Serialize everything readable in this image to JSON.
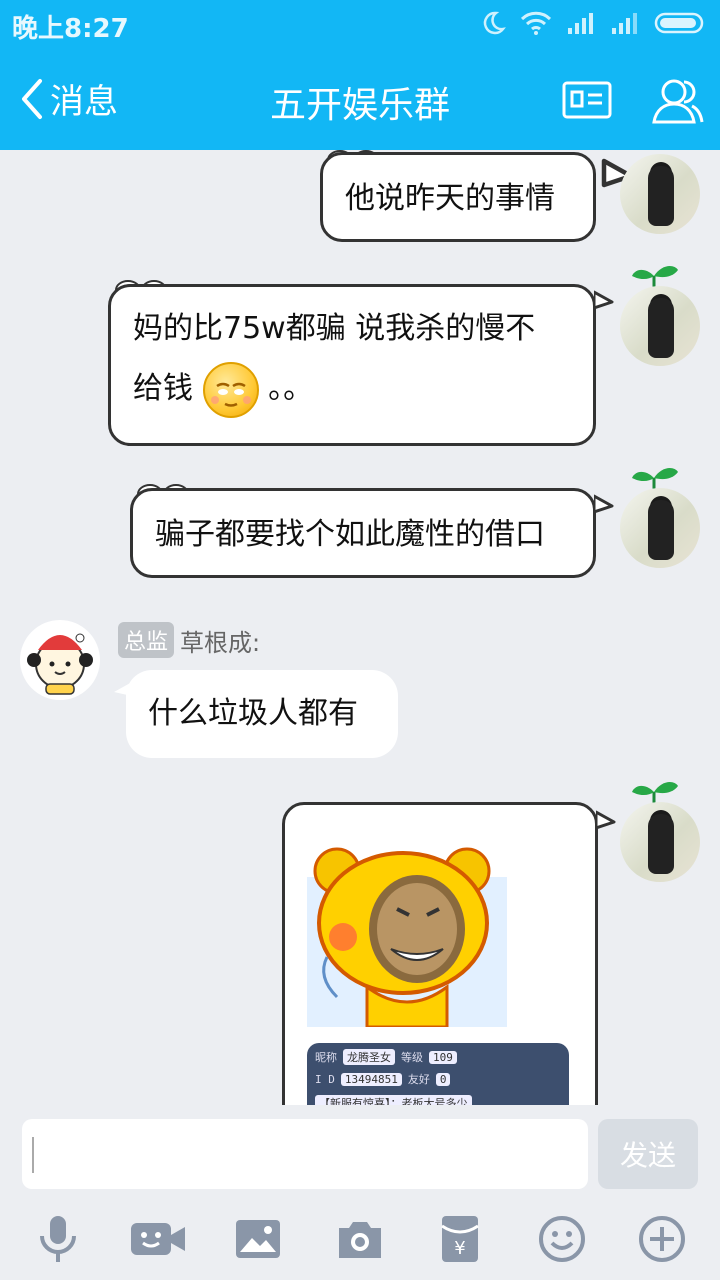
{
  "status_bar": {
    "time": "晚上8:27"
  },
  "header": {
    "back_label": "消息",
    "title": "五开娱乐群"
  },
  "messages": [
    {
      "text": "他说昨天的事情"
    },
    {
      "text_line1": "妈的比75w都骗 说我杀的慢不",
      "text_line2_prefix": "给钱",
      "text_line2_suffix": "。。"
    },
    {
      "text": "骗子都要找个如此魔性的借口"
    },
    {
      "badge": "总监",
      "sender": "草根成:",
      "text": "什么垃圾人都有"
    }
  ],
  "screenshot_card": {
    "row1_label": "昵称",
    "row1_value": "龙腾圣女",
    "row1_label2": "等级",
    "row1_value2": "109",
    "row2_label": "I D",
    "row2_value": "13494851",
    "row2_label2": "友好",
    "row2_value2": "0",
    "row3_text": "【新服有惊喜】：老板大号多少"
  },
  "input": {
    "placeholder": "",
    "send_label": "发送"
  },
  "toolbar": {
    "icons": [
      "microphone-icon",
      "video-call-icon",
      "image-icon",
      "camera-icon",
      "red-packet-icon",
      "smiley-icon",
      "plus-icon"
    ]
  },
  "colors": {
    "header_bg": "#12b7f5",
    "chat_bg": "#eceef2"
  }
}
